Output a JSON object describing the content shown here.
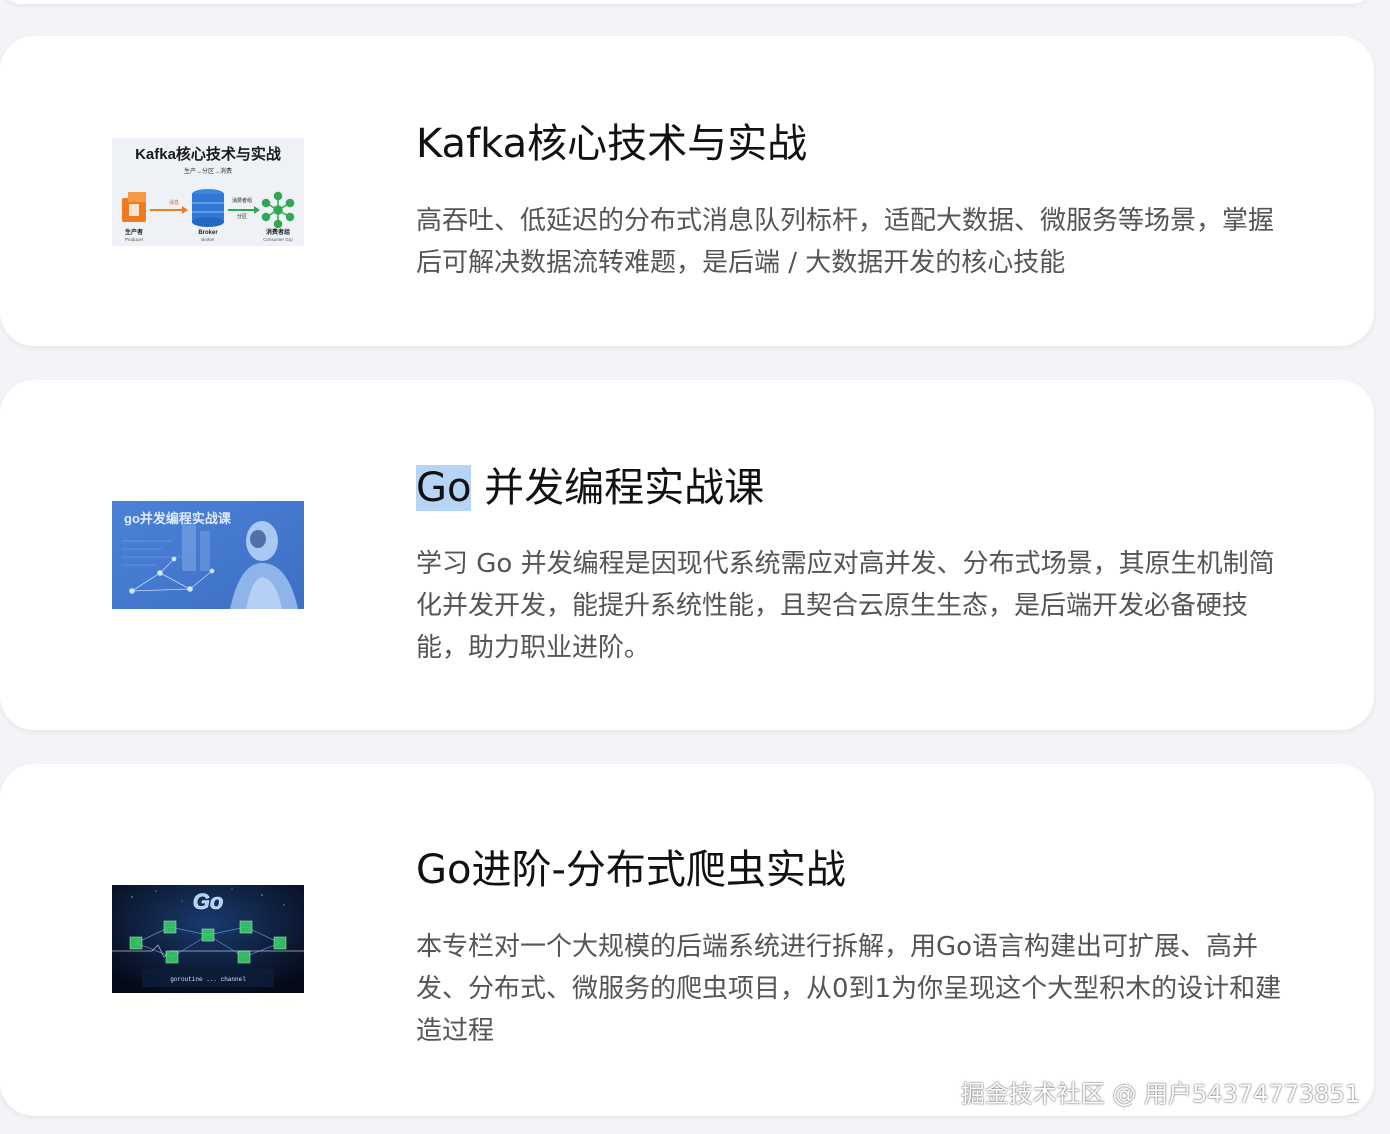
{
  "courses": [
    {
      "title": "Kafka核心技术与实战",
      "description": "高吞吐、低延迟的分布式消息队列标杆，适配大数据、微服务等场景，掌握后可解决数据流转难题，是后端 / 大数据开发的核心技能",
      "thumbnail": {
        "heading": "Kafka核心技术与实战",
        "flow": "生产→分区→消费",
        "labels": [
          "消息",
          "消费者组",
          "分区"
        ],
        "producer": "生产者",
        "producer_sub": "Producer",
        "broker": "Broker",
        "broker_sub": "Broker",
        "consumer": "消费者组",
        "consumer_sub": "Consumer Grp"
      }
    },
    {
      "title_highlight": "Go",
      "title_rest": " 并发编程实战课",
      "description": "学习 Go 并发编程是因现代系统需应对高并发、分布式场景，其原生机制简化并发开发，能提升系统性能，且契合云原生生态，是后端开发必备硬技能，助力职业进阶。",
      "thumbnail": {
        "heading": "go并发编程实战课"
      }
    },
    {
      "title": "Go进阶-分布式爬虫实战",
      "description": "本专栏对一个大规模的后端系统进行拆解，用Go语言构建出可扩展、高并发、分布式、微服务的爬虫项目，从0到1为你呈现这个大型积木的设计和建造过程",
      "thumbnail": {
        "logo": "Go",
        "code": "goroutine ... channel"
      }
    }
  ],
  "watermark": "掘金技术社区 @ 用户54374773851",
  "colors": {
    "background": "#f3f4f7",
    "card": "#ffffff",
    "title": "#111111",
    "description": "#555555",
    "selection": "#b6d4f5"
  }
}
